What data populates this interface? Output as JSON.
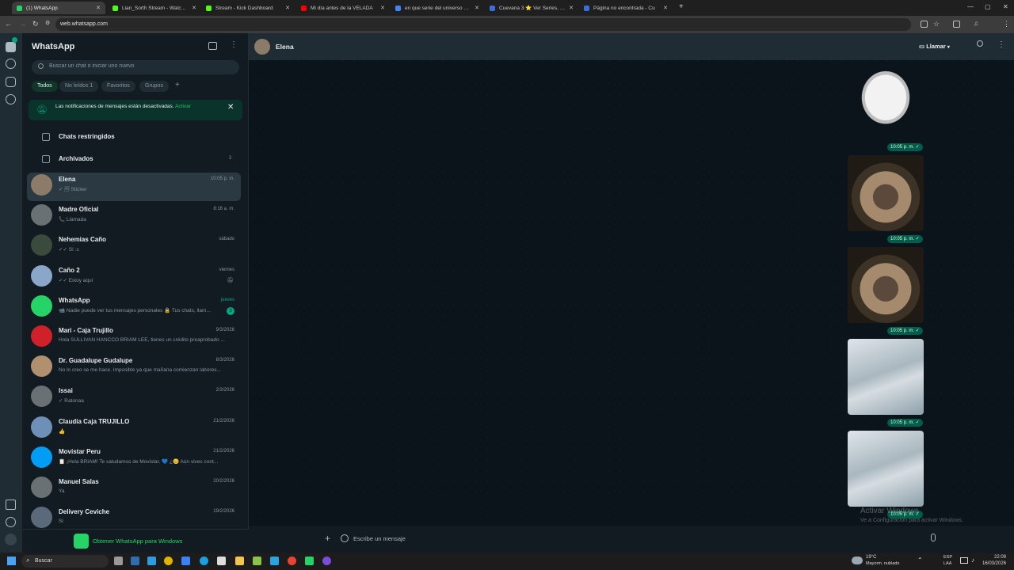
{
  "browser": {
    "tabs": [
      {
        "label": "(1) WhatsApp",
        "color": "#25d366",
        "active": true
      },
      {
        "label": "Lian_Sorth Stream - Watch Live",
        "color": "#53fc18"
      },
      {
        "label": "Stream - Kick Dashboard",
        "color": "#53fc18"
      },
      {
        "label": "Mi día antes de la VELADA",
        "color": "#ff0000"
      },
      {
        "label": "en que serie del universo de b",
        "color": "#4285f4"
      },
      {
        "label": "Cuevana 3 ⭐ Ver Series, Pelícu",
        "color": "#3b6ed8"
      },
      {
        "label": "Página no encontrada - Cu",
        "color": "#3b6ed8"
      }
    ],
    "new_tab": "+",
    "url": "web.whatsapp.com"
  },
  "sidebar": {
    "title": "WhatsApp",
    "search_placeholder": "Buscar un chat o iniciar uno nuevo",
    "filters": [
      "Todos",
      "No leídos 1",
      "Favoritos",
      "Grupos"
    ],
    "add_filter": "+",
    "notification": {
      "text": "Las notificaciones de mensajes están desactivadas.",
      "action": "Activar"
    },
    "restricted": "Chats restringidos",
    "archived": "Archivados",
    "archived_count": "2",
    "chats": [
      {
        "name": "Elena",
        "preview": "✓ 🗐 Sticker",
        "time": "10:05 p. m.",
        "avatar": "#8d7b6a"
      },
      {
        "name": "Madre Oficial",
        "preview": "📞 Llamada",
        "time": "8:16 a. m.",
        "avatar": "#6a7175"
      },
      {
        "name": "Nehemias Caño",
        "preview": "✓✓ Sí :c",
        "time": "sábado",
        "avatar": "#3a4a3c"
      },
      {
        "name": "Caño 2",
        "preview": "✓✓ Estoy aquí",
        "time": "viernes",
        "avatar": "#8aa6c9"
      },
      {
        "name": "WhatsApp",
        "preview": "📹 Nadie puede ver tus mensajes personales 🔒 Tus chats, llam...",
        "time": "jueves",
        "badge": "3",
        "avatar": "#25d366"
      },
      {
        "name": "Mari - Caja Trujillo",
        "preview": "Hola SULLIVAN HANCCO BRIAM LEE, tienes un crédito preaprobado ...",
        "time": "9/3/2026",
        "avatar": "#d0212a"
      },
      {
        "name": "Dr. Guadalupe Gudalupe",
        "preview": "No lo creo se me hace. Imposible ya que mañana comienzan labores...",
        "time": "8/3/2026",
        "avatar": "#b0906f"
      },
      {
        "name": "Issai",
        "preview": "✓ Ratonaa",
        "time": "2/3/2026",
        "avatar": "#6a7175"
      },
      {
        "name": "Claudia Caja TRUJILLO",
        "preview": "👍",
        "time": "21/2/2026",
        "avatar": "#6e8fb8"
      },
      {
        "name": "Movistar Peru",
        "preview": "📋 ¡Hola BRIAM! Te saludamos de Movistar. 💙 ¿😊 Aún vives cont...",
        "time": "21/2/2026",
        "avatar": "#019df4"
      },
      {
        "name": "Manuel Salas",
        "preview": "Ya",
        "time": "20/2/2026",
        "avatar": "#6a7175"
      },
      {
        "name": "Delivery Ceviche",
        "preview": "Si",
        "time": "19/2/2026",
        "avatar": "#5b6a7a"
      }
    ],
    "footer": "Obtener WhatsApp para Windows"
  },
  "conversation": {
    "contact": "Elena",
    "call_label": "Llamar",
    "stickers": [
      {
        "time": "10:05 p. m. ✓",
        "kind": "ghost"
      },
      {
        "time": "10:05 p. m. ✓",
        "kind": "cat"
      },
      {
        "time": "10:05 p. m. ✓",
        "kind": "cat"
      },
      {
        "time": "10:05 p. m. ✓",
        "kind": "hand"
      },
      {
        "time": "10:05 p. m. ✓",
        "kind": "hand"
      }
    ],
    "composer_placeholder": "Escribe un mensaje",
    "watermark_title": "Activar Windows",
    "watermark_sub": "Ve a Configuración para activar Windows."
  },
  "taskbar": {
    "search": "Buscar",
    "weather_temp": "19°C",
    "weather_desc": "Mayorm. nublado",
    "lang": "ESP",
    "lang2": "LAA",
    "time": "22:09",
    "date": "16/03/2026"
  }
}
